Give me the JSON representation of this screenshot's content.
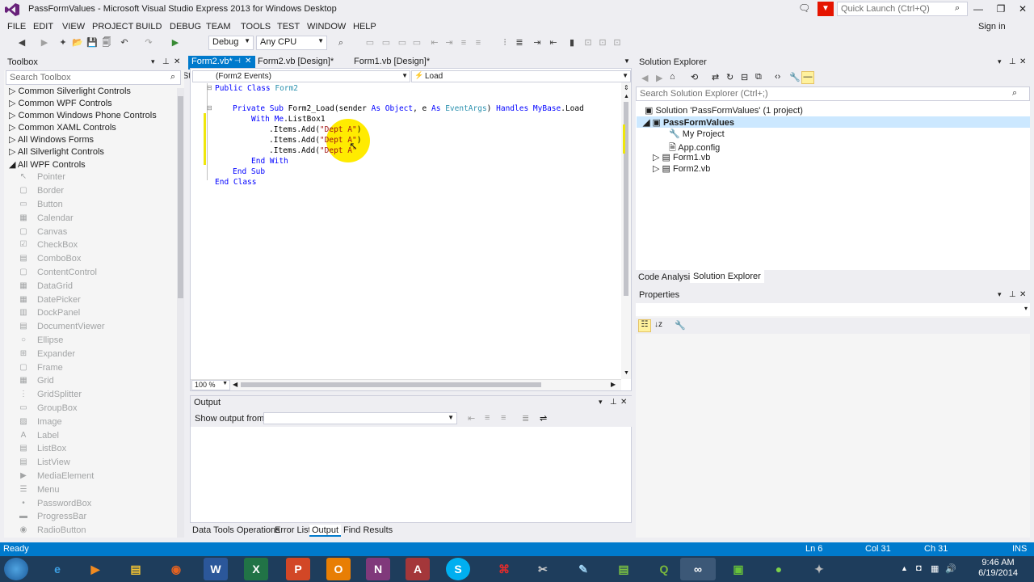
{
  "window": {
    "title": "PassFormValues - Microsoft Visual Studio Express 2013 for Windows Desktop",
    "quick_launch_placeholder": "Quick Launch (Ctrl+Q)",
    "minimize": "—",
    "maximize": "❐",
    "close": "✕",
    "sign_in": "Sign in"
  },
  "menu": [
    "FILE",
    "EDIT",
    "VIEW",
    "PROJECT",
    "BUILD",
    "DEBUG",
    "TEAM",
    "TOOLS",
    "TEST",
    "WINDOW",
    "HELP"
  ],
  "toolbar": {
    "start_label": "Start",
    "config": "Debug",
    "platform": "Any CPU"
  },
  "toolbox": {
    "title": "Toolbox",
    "search_placeholder": "Search Toolbox",
    "groups": [
      "Common Silverlight Controls",
      "Common WPF Controls",
      "Common Windows Phone Controls",
      "Common XAML Controls",
      "All Windows Forms",
      "All Silverlight Controls",
      "All WPF Controls"
    ],
    "items": [
      "Pointer",
      "Border",
      "Button",
      "Calendar",
      "Canvas",
      "CheckBox",
      "ComboBox",
      "ContentControl",
      "DataGrid",
      "DatePicker",
      "DockPanel",
      "DocumentViewer",
      "Ellipse",
      "Expander",
      "Frame",
      "Grid",
      "GridSplitter",
      "GroupBox",
      "Image",
      "Label",
      "ListBox",
      "ListView",
      "MediaElement",
      "Menu",
      "PasswordBox",
      "ProgressBar",
      "RadioButton"
    ]
  },
  "doc_tabs": [
    "Form2.vb*",
    "Form2.vb [Design]*",
    "Form1.vb [Design]*"
  ],
  "editor": {
    "class_combo": "(Form2 Events)",
    "method_combo": "Load",
    "zoom": "100 %",
    "code": {
      "l1a": "Public Class",
      "l1b": " Form2",
      "l2a": "Private Sub",
      "l2b": " Form2_Load(sender ",
      "l2c": "As",
      "l2d": " ",
      "l2e": "Object",
      "l2f": ", e ",
      "l2g": "As",
      "l2h": " ",
      "l2i": "EventArgs",
      "l2j": ") ",
      "l2k": "Handles",
      "l2l": " ",
      "l2m": "MyBase",
      "l2n": ".Load",
      "l3a": "With",
      "l3b": " ",
      "l3c": "Me",
      "l3d": ".ListBox1",
      "l4a": ".Items.Add(",
      "l4b": "\"Dept A\"",
      "l4c": ")",
      "l5a": ".Items.Add(",
      "l5b": "\"Dept A\"",
      "l5c": ")",
      "l6a": ".Items.Add(",
      "l6b": "\"Dept A\"",
      "l7": "End With",
      "l8": "End Sub",
      "l9": "End Class"
    }
  },
  "output": {
    "title": "Output",
    "show_from_label": "Show output from:"
  },
  "bottom_tabs": [
    "Data Tools Operations",
    "Error List",
    "Output",
    "Find Results"
  ],
  "solution_explorer": {
    "title": "Solution Explorer",
    "search_placeholder": "Search Solution Explorer (Ctrl+;)",
    "solution": "Solution 'PassFormValues' (1 project)",
    "project": "PassFormValues",
    "items": [
      "My Project",
      "App.config",
      "Form1.vb",
      "Form2.vb"
    ],
    "tabs": [
      "Code Analysis",
      "Solution Explorer"
    ]
  },
  "properties": {
    "title": "Properties"
  },
  "status": {
    "ready": "Ready",
    "ln": "Ln 6",
    "col": "Col 31",
    "ch": "Ch 31",
    "ins": "INS"
  },
  "taskbar": {
    "time": "9:46 AM",
    "date": "6/19/2014"
  },
  "colors": {
    "accent": "#007ACC",
    "vs_purple": "#68217A",
    "highlight": "#FFEB00"
  }
}
